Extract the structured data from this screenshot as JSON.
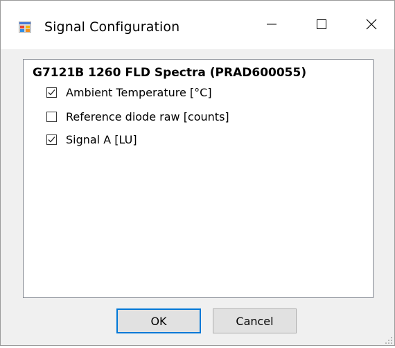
{
  "window": {
    "title": "Signal Configuration",
    "icon": "app-window-icon",
    "controls": {
      "minimize": "minimize-icon",
      "maximize": "maximize-icon",
      "close": "close-icon"
    }
  },
  "signals": {
    "group_title": "G7121B 1260 FLD Spectra (PRAD600055)",
    "items": [
      {
        "label": "Ambient Temperature [°C]",
        "checked": true
      },
      {
        "label": "Reference diode raw [counts]",
        "checked": false
      },
      {
        "label": "Signal A [LU]",
        "checked": true
      }
    ]
  },
  "buttons": {
    "ok_label": "OK",
    "cancel_label": "Cancel"
  },
  "colors": {
    "accent": "#0078d7",
    "window_bg": "#f0f0f0",
    "titlebar_bg": "#ffffff"
  }
}
